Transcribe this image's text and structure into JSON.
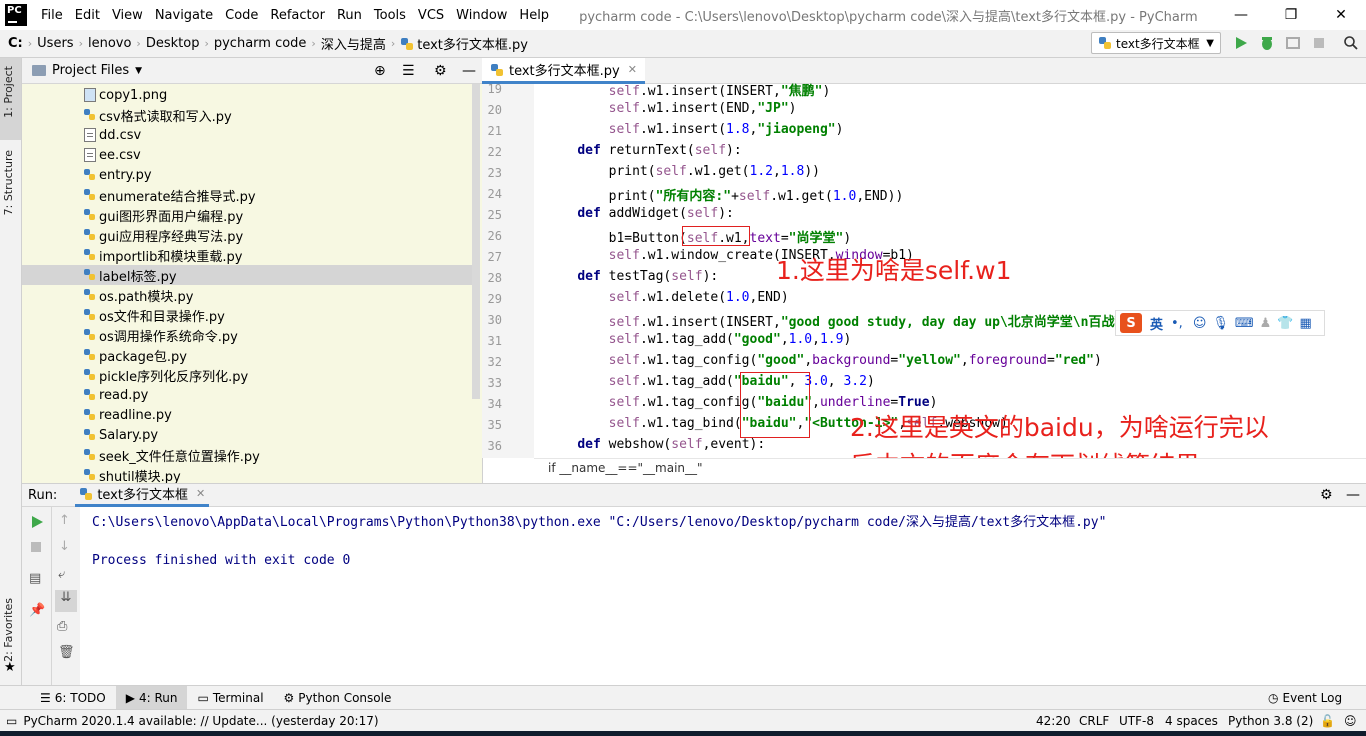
{
  "titlebar": {
    "logo": "PC",
    "menu": [
      "File",
      "Edit",
      "View",
      "Navigate",
      "Code",
      "Refactor",
      "Run",
      "Tools",
      "VCS",
      "Window",
      "Help"
    ],
    "window_title": "pycharm code - C:\\Users\\lenovo\\Desktop\\pycharm code\\深入与提高\\text多行文本框.py - PyCharm",
    "buttons": {
      "minimize": "—",
      "maximize": "❐",
      "close": "✕"
    }
  },
  "navbar": {
    "drive": "C:",
    "crumbs": [
      "Users",
      "lenovo",
      "Desktop",
      "pycharm code",
      "深入与提高",
      "text多行文本框.py"
    ],
    "run_config": "text多行文本框"
  },
  "left_strip": {
    "project_tab": "1: Project",
    "structure_tab": "7: Structure",
    "favorites_tab": "2: Favorites"
  },
  "project": {
    "header": "Project Files",
    "files": [
      {
        "name": "copy1.png",
        "type": "img"
      },
      {
        "name": "csv格式读取和写入.py",
        "type": "py"
      },
      {
        "name": "dd.csv",
        "type": "doc"
      },
      {
        "name": "ee.csv",
        "type": "doc"
      },
      {
        "name": "entry.py",
        "type": "py"
      },
      {
        "name": "enumerate结合推导式.py",
        "type": "py"
      },
      {
        "name": "gui图形界面用户编程.py",
        "type": "py"
      },
      {
        "name": "gui应用程序经典写法.py",
        "type": "py"
      },
      {
        "name": "importlib和模块重载.py",
        "type": "py"
      },
      {
        "name": "label标签.py",
        "type": "py",
        "selected": true
      },
      {
        "name": "os.path模块.py",
        "type": "py"
      },
      {
        "name": "os文件和目录操作.py",
        "type": "py"
      },
      {
        "name": "os调用操作系统命令.py",
        "type": "py"
      },
      {
        "name": "package包.py",
        "type": "py"
      },
      {
        "name": "pickle序列化反序列化.py",
        "type": "py"
      },
      {
        "name": "read.py",
        "type": "py"
      },
      {
        "name": "readline.py",
        "type": "py"
      },
      {
        "name": "Salary.py",
        "type": "py"
      },
      {
        "name": "seek_文件任意位置操作.py",
        "type": "py"
      },
      {
        "name": "shutil模块.py",
        "type": "py"
      }
    ]
  },
  "editor": {
    "tab": "text多行文本框.py",
    "lines": [
      {
        "n": "19",
        "html": "        <span class='slf'>self</span>.w1.insert(INSERT,<span class='str'>\"焦鹏\"</span>)"
      },
      {
        "n": "20",
        "html": "        <span class='slf'>self</span>.w1.insert(END,<span class='str'>\"JP\"</span>)"
      },
      {
        "n": "21",
        "html": "        <span class='slf'>self</span>.w1.insert(<span class='num'>1.8</span>,<span class='str'>\"jiaopeng\"</span>)"
      },
      {
        "n": "22",
        "html": "    <span class='kw'>def</span> returnText(<span class='slf'>self</span>):"
      },
      {
        "n": "23",
        "html": "        print(<span class='slf'>self</span>.w1.get(<span class='num'>1.2</span>,<span class='num'>1.8</span>))"
      },
      {
        "n": "24",
        "html": "        print(<span class='str'>\"所有内容:\"</span>+<span class='slf'>self</span>.w1.get(<span class='num'>1.0</span>,END))"
      },
      {
        "n": "25",
        "html": "    <span class='kw'>def</span> addWidget(<span class='slf'>self</span>):"
      },
      {
        "n": "26",
        "html": "        b1=Button(<span class='slf'>self</span>.w1,<span class='par'>text</span>=<span class='str'>\"尚学堂\"</span>)"
      },
      {
        "n": "27",
        "html": "        <span class='slf'>self</span>.w1.window_create(INSERT,<span class='par'>window</span>=b1)"
      },
      {
        "n": "28",
        "html": "    <span class='kw'>def</span> testTag(<span class='slf'>self</span>):"
      },
      {
        "n": "29",
        "html": "        <span class='slf'>self</span>.w1.delete(<span class='num'>1.0</span>,END)"
      },
      {
        "n": "30",
        "html": "        <span class='slf'>self</span>.w1.insert(INSERT,<span class='str'>\"good good study, day day up\\北京尚学堂\\n百战程序员</span>"
      },
      {
        "n": "31",
        "html": "        <span class='slf'>self</span>.w1.tag_add(<span class='str'>\"good\"</span>,<span class='num'>1.0</span>,<span class='num'>1.9</span>)"
      },
      {
        "n": "32",
        "html": "        <span class='slf'>self</span>.w1.tag_config(<span class='str'>\"good\"</span>,<span class='par'>background</span>=<span class='str'>\"yellow\"</span>,<span class='par'>foreground</span>=<span class='str'>\"red\"</span>)"
      },
      {
        "n": "33",
        "html": "        <span class='slf'>self</span>.w1.tag_add(<span class='str'>\"baidu\"</span>, <span class='num'>3.0</span>, <span class='num'>3.2</span>)"
      },
      {
        "n": "34",
        "html": "        <span class='slf'>self</span>.w1.tag_config(<span class='str'>\"baidu\"</span>,<span class='par'>underline</span>=<span class='kw'>True</span>)"
      },
      {
        "n": "35",
        "html": "        <span class='slf'>self</span>.w1.tag_bind(<span class='str'>\"baidu\"</span>,<span class='str'>\"&lt;Button-1&gt;\"</span>,<span class='slf'>self</span>.webshow)"
      },
      {
        "n": "36",
        "html": "    <span class='kw'>def</span> webshow(<span class='slf'>self</span>,event):"
      }
    ],
    "footer_crumb": "if __name__==\"__main__\""
  },
  "annotations": {
    "a1": "1.这里为啥是self.w1",
    "a2_line1": "2.这里是英文的baidu，为啥运行完以",
    "a2_line2": "后中文的百度会有下划线等结果"
  },
  "ime": {
    "logo": "S",
    "lang": "英",
    "punct": "•,"
  },
  "run": {
    "label": "Run:",
    "tab": "text多行文本框",
    "cmd": "C:\\Users\\lenovo\\AppData\\Local\\Programs\\Python\\Python38\\python.exe \"C:/Users/lenovo/Desktop/pycharm code/深入与提高/text多行文本框.py\"",
    "exit": "Process finished with exit code 0"
  },
  "bottom_tabs": [
    "6: TODO",
    "4: Run",
    "Terminal",
    "Python Console"
  ],
  "event_log": "Event Log",
  "status": {
    "message": "PyCharm 2020.1.4 available: // Update... (yesterday 20:17)",
    "position": "42:20",
    "line_sep": "CRLF",
    "encoding": "UTF-8",
    "indent": "4 spaces",
    "interpreter": "Python 3.8 (2)"
  },
  "colors": {
    "accent": "#4083c9",
    "annotation": "#e8211c",
    "project_bg": "#f7f8e2"
  }
}
